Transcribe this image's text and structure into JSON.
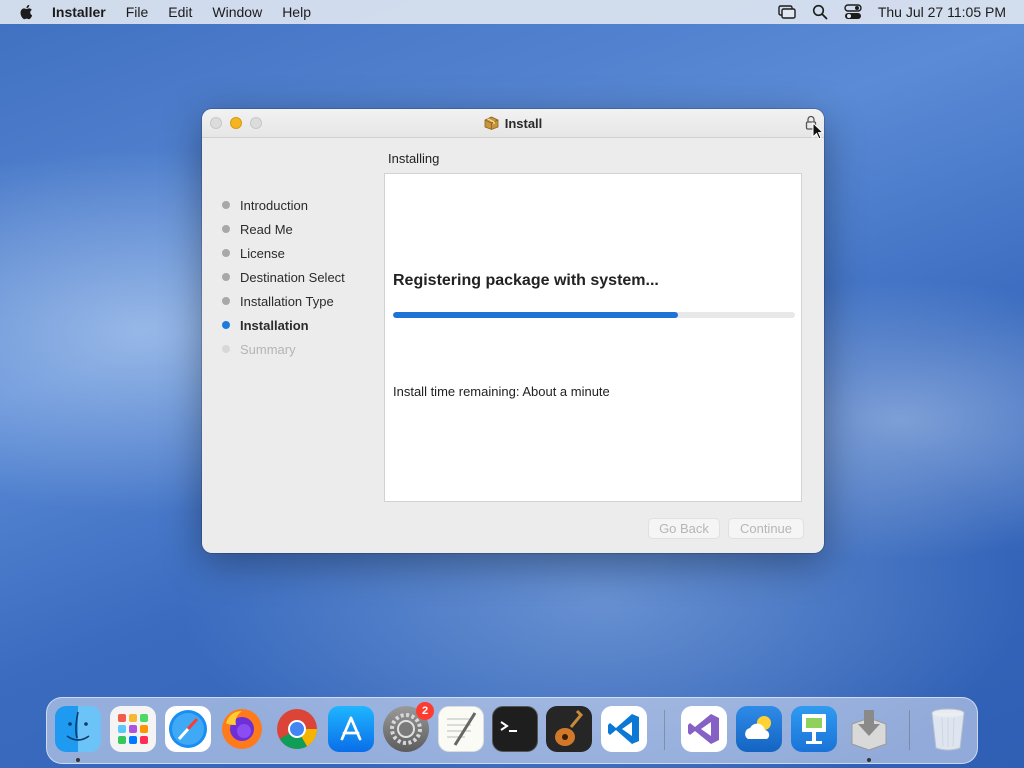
{
  "menubar": {
    "app_name": "Installer",
    "menus": [
      "File",
      "Edit",
      "Window",
      "Help"
    ],
    "clock": "Thu Jul 27  11:05 PM"
  },
  "window": {
    "title": "Install",
    "section_title": "Installing",
    "steps": [
      {
        "label": "Introduction",
        "state": "done"
      },
      {
        "label": "Read Me",
        "state": "done"
      },
      {
        "label": "License",
        "state": "done"
      },
      {
        "label": "Destination Select",
        "state": "done"
      },
      {
        "label": "Installation Type",
        "state": "done"
      },
      {
        "label": "Installation",
        "state": "active"
      },
      {
        "label": "Summary",
        "state": "future"
      }
    ],
    "status_text": "Registering package with system...",
    "progress_percent": 71,
    "remaining_text": "Install time remaining: About a minute",
    "back_label": "Go Back",
    "continue_label": "Continue"
  },
  "dock": {
    "apps": [
      {
        "name": "Finder",
        "icon": "finder-icon",
        "running": true
      },
      {
        "name": "Launchpad",
        "icon": "launchpad-icon",
        "running": false
      },
      {
        "name": "Safari",
        "icon": "safari-icon",
        "running": false
      },
      {
        "name": "Firefox",
        "icon": "firefox-icon",
        "running": false
      },
      {
        "name": "Chrome",
        "icon": "chrome-icon",
        "running": false
      },
      {
        "name": "App Store",
        "icon": "app-store-icon",
        "running": false
      },
      {
        "name": "System Preferences",
        "icon": "system-preferences-icon",
        "running": false,
        "badge": "2"
      },
      {
        "name": "TextEdit",
        "icon": "textedit-icon",
        "running": false
      },
      {
        "name": "Terminal",
        "icon": "terminal-icon",
        "running": false
      },
      {
        "name": "GarageBand",
        "icon": "garageband-icon",
        "running": false
      },
      {
        "name": "Visual Studio Code",
        "icon": "vscode-icon",
        "running": false
      },
      {
        "name": "Visual Studio",
        "icon": "visual-studio-icon",
        "running": false
      },
      {
        "name": "Weather",
        "icon": "weather-icon",
        "running": false
      },
      {
        "name": "Keynote",
        "icon": "keynote-icon",
        "running": false
      },
      {
        "name": "Installer",
        "icon": "installer-icon",
        "running": true
      },
      {
        "name": "Trash",
        "icon": "trash-icon",
        "running": false
      }
    ]
  },
  "colors": {
    "accent": "#1f72d6",
    "minimize": "#f5b521",
    "badge": "#ff3b30"
  }
}
